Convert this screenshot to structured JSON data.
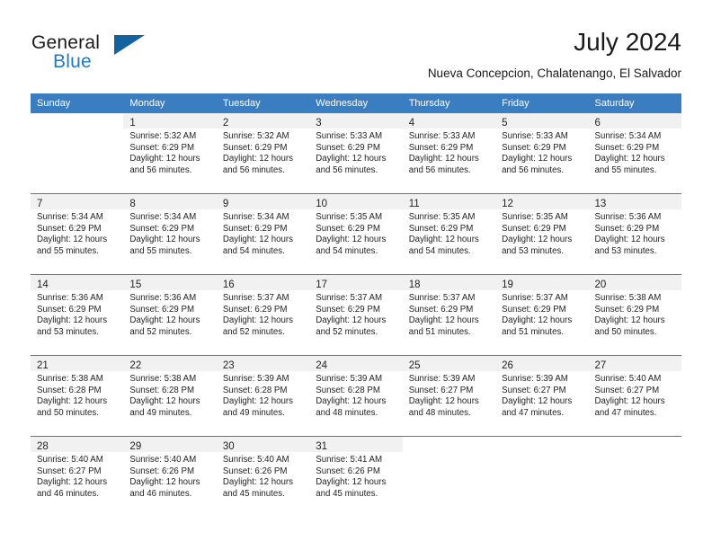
{
  "brand": {
    "name_part1": "General",
    "name_part2": "Blue",
    "accent_color": "#1362a0",
    "blue_text_color": "#1f7ac4"
  },
  "header": {
    "month_title": "July 2024",
    "location": "Nueva Concepcion, Chalatenango, El Salvador"
  },
  "calendar": {
    "header_bg": "#3a7dc0",
    "daynum_band_bg": "#f1f1f1",
    "weekday_headers": [
      "Sunday",
      "Monday",
      "Tuesday",
      "Wednesday",
      "Thursday",
      "Friday",
      "Saturday"
    ],
    "weeks": [
      [
        {
          "day": "",
          "lines": []
        },
        {
          "day": "1",
          "lines": [
            "Sunrise: 5:32 AM",
            "Sunset: 6:29 PM",
            "Daylight: 12 hours",
            "and 56 minutes."
          ]
        },
        {
          "day": "2",
          "lines": [
            "Sunrise: 5:32 AM",
            "Sunset: 6:29 PM",
            "Daylight: 12 hours",
            "and 56 minutes."
          ]
        },
        {
          "day": "3",
          "lines": [
            "Sunrise: 5:33 AM",
            "Sunset: 6:29 PM",
            "Daylight: 12 hours",
            "and 56 minutes."
          ]
        },
        {
          "day": "4",
          "lines": [
            "Sunrise: 5:33 AM",
            "Sunset: 6:29 PM",
            "Daylight: 12 hours",
            "and 56 minutes."
          ]
        },
        {
          "day": "5",
          "lines": [
            "Sunrise: 5:33 AM",
            "Sunset: 6:29 PM",
            "Daylight: 12 hours",
            "and 56 minutes."
          ]
        },
        {
          "day": "6",
          "lines": [
            "Sunrise: 5:34 AM",
            "Sunset: 6:29 PM",
            "Daylight: 12 hours",
            "and 55 minutes."
          ]
        }
      ],
      [
        {
          "day": "7",
          "lines": [
            "Sunrise: 5:34 AM",
            "Sunset: 6:29 PM",
            "Daylight: 12 hours",
            "and 55 minutes."
          ]
        },
        {
          "day": "8",
          "lines": [
            "Sunrise: 5:34 AM",
            "Sunset: 6:29 PM",
            "Daylight: 12 hours",
            "and 55 minutes."
          ]
        },
        {
          "day": "9",
          "lines": [
            "Sunrise: 5:34 AM",
            "Sunset: 6:29 PM",
            "Daylight: 12 hours",
            "and 54 minutes."
          ]
        },
        {
          "day": "10",
          "lines": [
            "Sunrise: 5:35 AM",
            "Sunset: 6:29 PM",
            "Daylight: 12 hours",
            "and 54 minutes."
          ]
        },
        {
          "day": "11",
          "lines": [
            "Sunrise: 5:35 AM",
            "Sunset: 6:29 PM",
            "Daylight: 12 hours",
            "and 54 minutes."
          ]
        },
        {
          "day": "12",
          "lines": [
            "Sunrise: 5:35 AM",
            "Sunset: 6:29 PM",
            "Daylight: 12 hours",
            "and 53 minutes."
          ]
        },
        {
          "day": "13",
          "lines": [
            "Sunrise: 5:36 AM",
            "Sunset: 6:29 PM",
            "Daylight: 12 hours",
            "and 53 minutes."
          ]
        }
      ],
      [
        {
          "day": "14",
          "lines": [
            "Sunrise: 5:36 AM",
            "Sunset: 6:29 PM",
            "Daylight: 12 hours",
            "and 53 minutes."
          ]
        },
        {
          "day": "15",
          "lines": [
            "Sunrise: 5:36 AM",
            "Sunset: 6:29 PM",
            "Daylight: 12 hours",
            "and 52 minutes."
          ]
        },
        {
          "day": "16",
          "lines": [
            "Sunrise: 5:37 AM",
            "Sunset: 6:29 PM",
            "Daylight: 12 hours",
            "and 52 minutes."
          ]
        },
        {
          "day": "17",
          "lines": [
            "Sunrise: 5:37 AM",
            "Sunset: 6:29 PM",
            "Daylight: 12 hours",
            "and 52 minutes."
          ]
        },
        {
          "day": "18",
          "lines": [
            "Sunrise: 5:37 AM",
            "Sunset: 6:29 PM",
            "Daylight: 12 hours",
            "and 51 minutes."
          ]
        },
        {
          "day": "19",
          "lines": [
            "Sunrise: 5:37 AM",
            "Sunset: 6:29 PM",
            "Daylight: 12 hours",
            "and 51 minutes."
          ]
        },
        {
          "day": "20",
          "lines": [
            "Sunrise: 5:38 AM",
            "Sunset: 6:29 PM",
            "Daylight: 12 hours",
            "and 50 minutes."
          ]
        }
      ],
      [
        {
          "day": "21",
          "lines": [
            "Sunrise: 5:38 AM",
            "Sunset: 6:28 PM",
            "Daylight: 12 hours",
            "and 50 minutes."
          ]
        },
        {
          "day": "22",
          "lines": [
            "Sunrise: 5:38 AM",
            "Sunset: 6:28 PM",
            "Daylight: 12 hours",
            "and 49 minutes."
          ]
        },
        {
          "day": "23",
          "lines": [
            "Sunrise: 5:39 AM",
            "Sunset: 6:28 PM",
            "Daylight: 12 hours",
            "and 49 minutes."
          ]
        },
        {
          "day": "24",
          "lines": [
            "Sunrise: 5:39 AM",
            "Sunset: 6:28 PM",
            "Daylight: 12 hours",
            "and 48 minutes."
          ]
        },
        {
          "day": "25",
          "lines": [
            "Sunrise: 5:39 AM",
            "Sunset: 6:27 PM",
            "Daylight: 12 hours",
            "and 48 minutes."
          ]
        },
        {
          "day": "26",
          "lines": [
            "Sunrise: 5:39 AM",
            "Sunset: 6:27 PM",
            "Daylight: 12 hours",
            "and 47 minutes."
          ]
        },
        {
          "day": "27",
          "lines": [
            "Sunrise: 5:40 AM",
            "Sunset: 6:27 PM",
            "Daylight: 12 hours",
            "and 47 minutes."
          ]
        }
      ],
      [
        {
          "day": "28",
          "lines": [
            "Sunrise: 5:40 AM",
            "Sunset: 6:27 PM",
            "Daylight: 12 hours",
            "and 46 minutes."
          ]
        },
        {
          "day": "29",
          "lines": [
            "Sunrise: 5:40 AM",
            "Sunset: 6:26 PM",
            "Daylight: 12 hours",
            "and 46 minutes."
          ]
        },
        {
          "day": "30",
          "lines": [
            "Sunrise: 5:40 AM",
            "Sunset: 6:26 PM",
            "Daylight: 12 hours",
            "and 45 minutes."
          ]
        },
        {
          "day": "31",
          "lines": [
            "Sunrise: 5:41 AM",
            "Sunset: 6:26 PM",
            "Daylight: 12 hours",
            "and 45 minutes."
          ]
        },
        {
          "day": "",
          "lines": []
        },
        {
          "day": "",
          "lines": []
        },
        {
          "day": "",
          "lines": []
        }
      ]
    ]
  }
}
